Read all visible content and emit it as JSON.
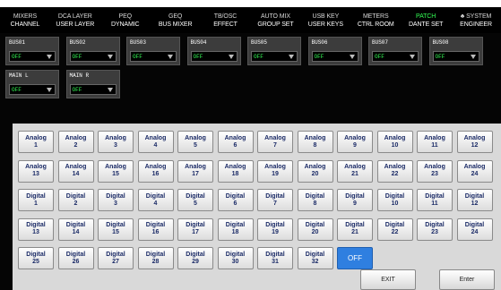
{
  "tabs": [
    {
      "line1": "MIXERS",
      "line2": "CHANNEL",
      "active": false
    },
    {
      "line1": "DCA LAYER",
      "line2": "USER LAYER",
      "active": false
    },
    {
      "line1": "PEQ",
      "line2": "DYNAMIC",
      "active": false
    },
    {
      "line1": "GEQ",
      "line2": "BUS MIXER",
      "active": false
    },
    {
      "line1": "TB/OSC",
      "line2": "EFFECT",
      "active": false
    },
    {
      "line1": "AUTO MIX",
      "line2": "GROUP SET",
      "active": false
    },
    {
      "line1": "USB KEY",
      "line2": "USER KEYS",
      "active": false
    },
    {
      "line1": "METERS",
      "line2": "CTRL ROOM",
      "active": false
    },
    {
      "line1": "PATCH",
      "line2": "DANTE SET",
      "active": true
    },
    {
      "line1": "♣ SYSTEM",
      "line2": "ENGINEER",
      "active": false
    }
  ],
  "buses": [
    {
      "label": "BUS01",
      "value": "OFF"
    },
    {
      "label": "BUS02",
      "value": "OFF"
    },
    {
      "label": "BUS03",
      "value": "OFF"
    },
    {
      "label": "BUS04",
      "value": "OFF"
    },
    {
      "label": "BUS05",
      "value": "OFF"
    },
    {
      "label": "BUS06",
      "value": "OFF"
    },
    {
      "label": "BUS07",
      "value": "OFF"
    },
    {
      "label": "BUS08",
      "value": "OFF"
    },
    {
      "label": "MAIN L",
      "value": "OFF"
    },
    {
      "label": "MAIN R",
      "value": "OFF"
    }
  ],
  "sources": {
    "analog_label": "Analog",
    "digital_label": "Digital",
    "analog_numbers": [
      "1",
      "2",
      "3",
      "4",
      "5",
      "6",
      "7",
      "8",
      "9",
      "10",
      "11",
      "12",
      "13",
      "14",
      "15",
      "16",
      "17",
      "18",
      "19",
      "20",
      "21",
      "22",
      "23",
      "24"
    ],
    "digital_numbers": [
      "1",
      "2",
      "3",
      "4",
      "5",
      "6",
      "7",
      "8",
      "9",
      "10",
      "11",
      "12",
      "13",
      "14",
      "15",
      "16",
      "17",
      "18",
      "19",
      "20",
      "21",
      "22",
      "23",
      "24",
      "25",
      "26",
      "27",
      "28",
      "29",
      "30",
      "31",
      "32"
    ],
    "off_label": "OFF"
  },
  "actions": {
    "exit_label": "EXIT",
    "enter_label": "Enter"
  },
  "colors": {
    "active_tab": "#33ff55",
    "off_button": "#2f7fe0",
    "value_text": "#33ff55"
  }
}
